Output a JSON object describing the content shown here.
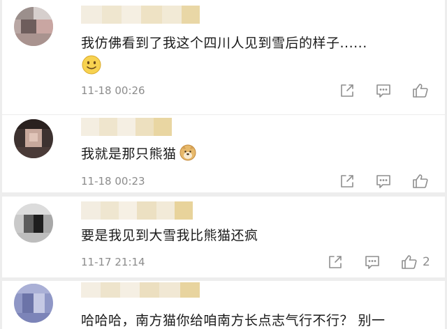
{
  "comments": [
    {
      "text": "我仿佛看到了我这个四川人见到雪后的样子......",
      "emoji": "slightly-smiling-face",
      "time": "11-18 00:26",
      "likes": ""
    },
    {
      "text": "我就是那只熊猫",
      "emoji": "doge-face",
      "time": "11-18 00:23",
      "likes": ""
    },
    {
      "text": "要是我见到大雪我比熊猫还疯",
      "time": "11-17 21:14",
      "likes": "2"
    },
    {
      "text": "哈哈哈，南方猫你给咱南方长点志气行不行？ 别一"
    }
  ],
  "actions": {
    "share_icon": "share-out-icon",
    "reply_icon": "comment-bubble-icon",
    "like_icon": "thumbs-up-icon"
  },
  "colors": {
    "background": "#ededed",
    "card": "#ffffff",
    "text": "#1a1a1a",
    "meta": "#8c8c8c",
    "icon": "#8e8e8e"
  }
}
